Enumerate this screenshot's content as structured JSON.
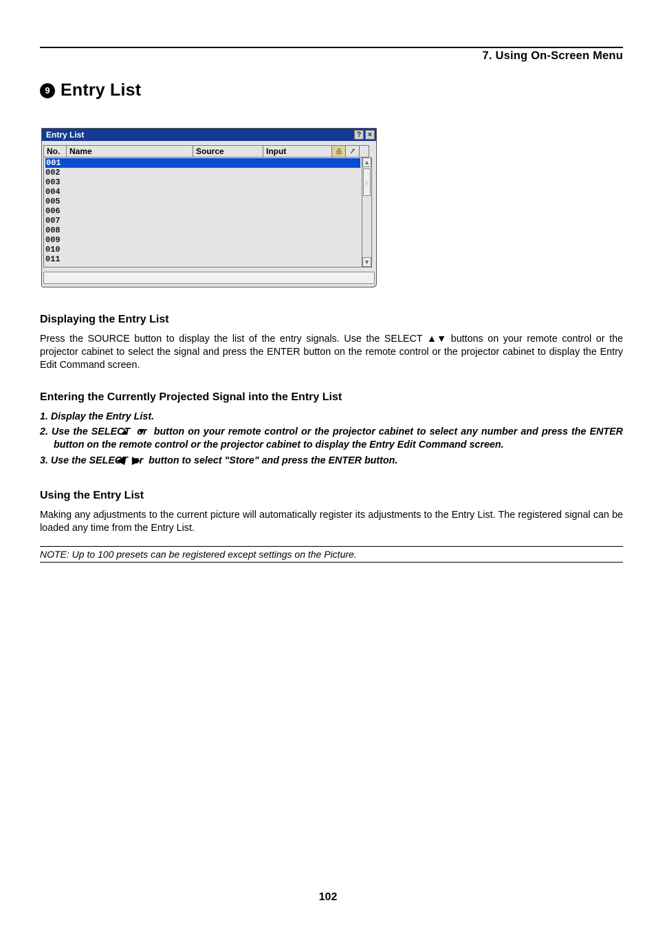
{
  "header": {
    "chapter": "7. Using On-Screen Menu",
    "section_num": "9",
    "title": "Entry List"
  },
  "entry_list": {
    "title": "Entry List",
    "columns": [
      "No.",
      "Name",
      "Source",
      "Input"
    ],
    "rows": [
      "001",
      "002",
      "003",
      "004",
      "005",
      "006",
      "007",
      "008",
      "009",
      "010",
      "011"
    ],
    "selected_index": 0
  },
  "sections": {
    "displaying": {
      "heading": "Displaying the Entry List",
      "body_a": "Press the SOURCE button to display the list of the entry signals. Use the SELECT ",
      "body_b": " buttons on your remote control or the projector cabinet to select the signal and press the ENTER button on the remote control or the projector cabinet to display the Entry Edit Command screen."
    },
    "entering": {
      "heading": "Entering the Currently Projected Signal into the Entry List",
      "step1": "1.  Display the Entry List.",
      "step2a": "2.  Use the SELECT ",
      "step2b": " or ",
      "step2c": " button on your remote control or the projector cabinet to select any number and press the ENTER button on the remote control or the projector cabinet to display the Entry Edit Command screen.",
      "step3a": "3.  Use the SELECT ",
      "step3b": " or ",
      "step3c": " button to select \"Store\" and press the ENTER button."
    },
    "using": {
      "heading": "Using the Entry List",
      "body": "Making any adjustments to the current picture will automatically register its adjustments to the Entry List. The registered signal can be loaded any time from the Entry List."
    },
    "note": "NOTE: Up to 100 presets can be registered except settings on the Picture."
  },
  "footer": {
    "page": "102"
  }
}
